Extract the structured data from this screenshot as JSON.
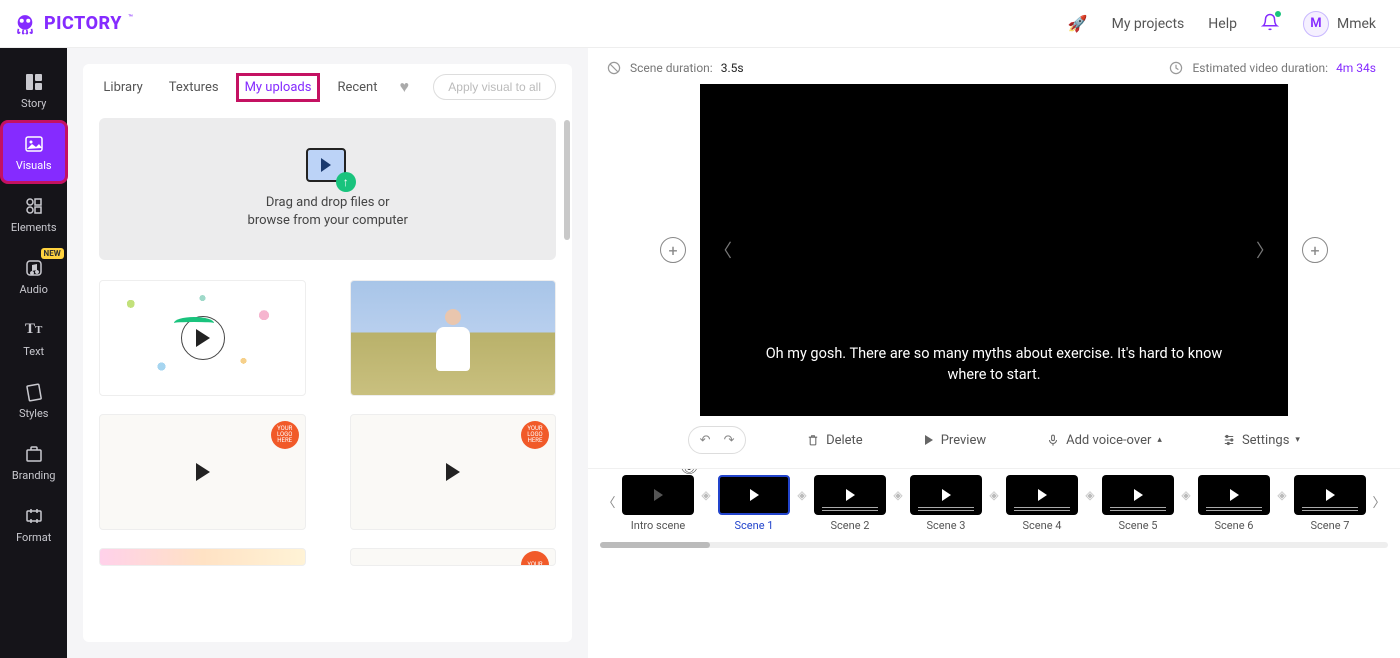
{
  "brand": {
    "name": "PICTORY",
    "tm": "™"
  },
  "header": {
    "myProjects": "My projects",
    "help": "Help",
    "userInitial": "M",
    "userName": "Mmek"
  },
  "sidebar": [
    {
      "id": "story",
      "label": "Story"
    },
    {
      "id": "visuals",
      "label": "Visuals"
    },
    {
      "id": "elements",
      "label": "Elements"
    },
    {
      "id": "audio",
      "label": "Audio",
      "badge": "NEW"
    },
    {
      "id": "text",
      "label": "Text"
    },
    {
      "id": "styles",
      "label": "Styles"
    },
    {
      "id": "branding",
      "label": "Branding"
    },
    {
      "id": "format",
      "label": "Format"
    }
  ],
  "panel": {
    "tabs": {
      "library": "Library",
      "textures": "Textures",
      "myUploads": "My uploads",
      "recent": "Recent"
    },
    "applyAll": "Apply visual to all",
    "dropzone": {
      "line1": "Drag and drop files or",
      "line2": "browse from your computer"
    }
  },
  "preview": {
    "sceneDurationLabel": "Scene duration:",
    "sceneDurationValue": "3.5s",
    "estimatedLabel": "Estimated video duration:",
    "estimatedValue": "4m 34s",
    "caption": "Oh my gosh. There are so many myths about exercise. It's hard to know where to start.",
    "controls": {
      "delete": "Delete",
      "preview": "Preview",
      "voiceover": "Add voice-over",
      "settings": "Settings"
    }
  },
  "scenes": [
    {
      "label": "Intro scene"
    },
    {
      "label": "Scene 1"
    },
    {
      "label": "Scene 2"
    },
    {
      "label": "Scene 3"
    },
    {
      "label": "Scene 4"
    },
    {
      "label": "Scene 5"
    },
    {
      "label": "Scene 6"
    },
    {
      "label": "Scene 7"
    }
  ]
}
